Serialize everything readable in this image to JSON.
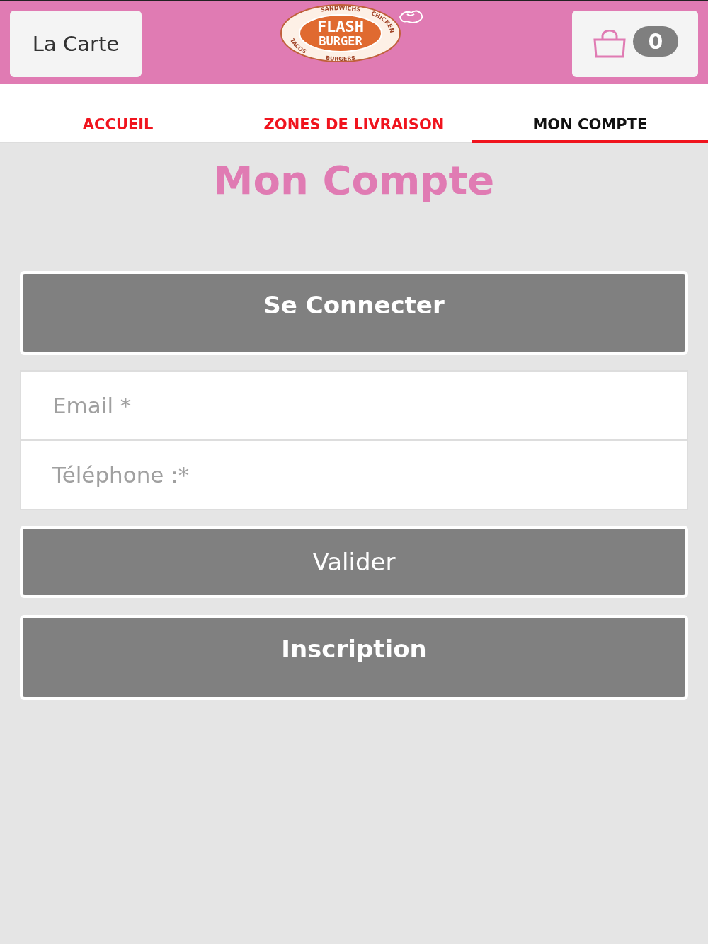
{
  "header": {
    "menu_button": "La Carte",
    "logo": {
      "top": "FLASH",
      "bottom": "BURGER",
      "ring": [
        "SANDWICHS",
        "CHICKEN",
        "BURGERS",
        "TACOS"
      ]
    },
    "cart_count": "0"
  },
  "tabs": [
    {
      "label": "ACCUEIL",
      "selected": false
    },
    {
      "label": "ZONES DE LIVRAISON",
      "selected": false
    },
    {
      "label": "MON COMPTE",
      "selected": true
    }
  ],
  "title": "Mon Compte",
  "login_button": "Se Connecter",
  "fields": [
    {
      "placeholder": "Email *"
    },
    {
      "placeholder": "Téléphone :*"
    }
  ],
  "submit_button": "Valider",
  "signup_button": "Inscription"
}
